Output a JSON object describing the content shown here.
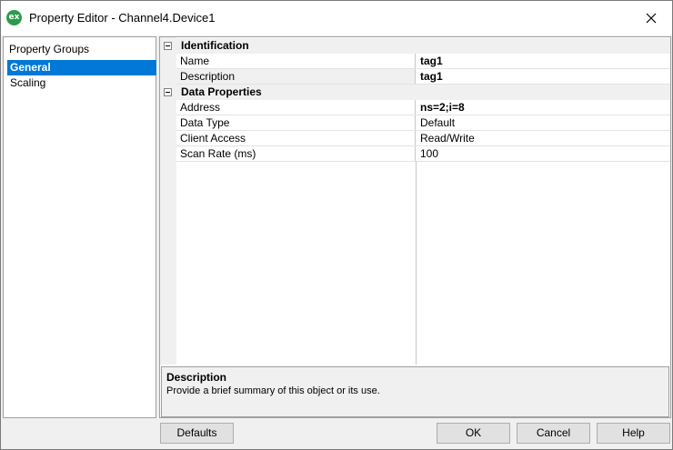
{
  "window": {
    "title": "Property Editor - Channel4.Device1",
    "app_icon_text": "ex",
    "close_icon": "close-icon"
  },
  "property_groups": {
    "header": "Property Groups",
    "items": [
      {
        "label": "General",
        "selected": true
      },
      {
        "label": "Scaling",
        "selected": false
      }
    ]
  },
  "grid": {
    "categories": [
      {
        "label": "Identification",
        "rows": [
          {
            "name": "Name",
            "value": "tag1"
          },
          {
            "name": "Description",
            "value": "tag1"
          }
        ]
      },
      {
        "label": "Data Properties",
        "rows": [
          {
            "name": "Address",
            "value": "ns=2;i=8"
          },
          {
            "name": "Data Type",
            "value": "Default"
          },
          {
            "name": "Client Access",
            "value": "Read/Write"
          },
          {
            "name": "Scan Rate (ms)",
            "value": "100"
          }
        ]
      }
    ]
  },
  "description": {
    "title": "Description",
    "body": "Provide a brief summary of this object or its use."
  },
  "buttons": {
    "defaults": "Defaults",
    "ok": "OK",
    "cancel": "Cancel",
    "help": "Help"
  },
  "colors": {
    "selection": "#0078d7",
    "app_icon": "#2c9b4a"
  }
}
